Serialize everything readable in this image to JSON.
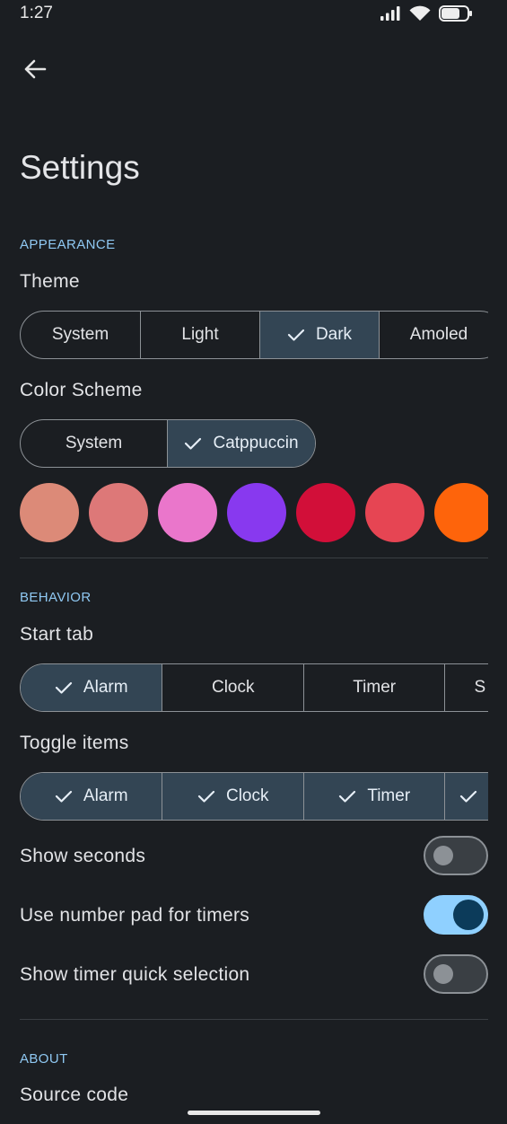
{
  "status_bar": {
    "time": "1:27"
  },
  "header": {
    "title": "Settings"
  },
  "appearance": {
    "section": "APPEARANCE",
    "theme_label": "Theme",
    "theme_options": [
      "System",
      "Light",
      "Dark",
      "Amoled"
    ],
    "theme_selected": "Dark",
    "color_scheme_label": "Color Scheme",
    "color_scheme_options": [
      "System",
      "Catppuccin"
    ],
    "color_scheme_selected": "Catppuccin",
    "swatches": [
      "#dc8a78",
      "#dd7878",
      "#ea76cb",
      "#8839ef",
      "#d20f39",
      "#e64553",
      "#fe640b"
    ]
  },
  "behavior": {
    "section": "BEHAVIOR",
    "start_tab_label": "Start tab",
    "start_tab_options": [
      "Alarm",
      "Clock",
      "Timer",
      "S"
    ],
    "start_tab_selected": "Alarm",
    "toggle_items_label": "Toggle items",
    "toggle_items_options": [
      "Alarm",
      "Clock",
      "Timer"
    ],
    "show_seconds_label": "Show seconds",
    "show_seconds": false,
    "number_pad_label": "Use number pad for timers",
    "number_pad": true,
    "quick_selection_label": "Show timer quick selection",
    "quick_selection": false
  },
  "about": {
    "section": "ABOUT",
    "source_code_label": "Source code"
  },
  "colors": {
    "background": "#1b1e22",
    "accent": "#8fc8f2",
    "selected_segment": "#334554",
    "switch_on": "#8fd0ff"
  }
}
